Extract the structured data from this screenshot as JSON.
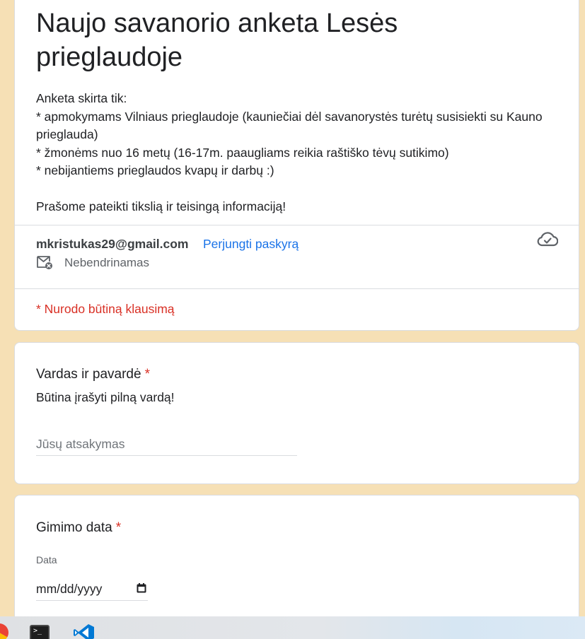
{
  "header": {
    "title": "Naujo savanorio anketa Lesės prieglaudoje",
    "description": "Anketa skirta tik:\n* apmokymams Vilniaus prieglaudoje (kauniečiai dėl savanorystės turėtų susisiekti su Kauno prieglauda)\n* žmonėms nuo 16 metų (16-17m. paaugliams reikia raštiško tėvų sutikimo)\n* nebijantiems prieglaudos kvapų ir darbų :)\n\nPrašome pateikti tikslią ir teisingą informaciją!",
    "account_email": "mkristukas29@gmail.com",
    "switch_account": "Perjungti paskyrą",
    "not_shared": "Nebendrinamas",
    "required_note": "* Nurodo būtiną klausimą"
  },
  "questions": [
    {
      "title": "Vardas ir pavardė",
      "required_mark": "*",
      "description": "Būtina įrašyti pilną vardą!",
      "placeholder": "Jūsų atsakymas"
    },
    {
      "title": "Gimimo data",
      "required_mark": "*",
      "date_label": "Data",
      "date_format": "mm/dd/yyyy"
    }
  ],
  "taskbar": {
    "terminal_prompt": ">_"
  },
  "colors": {
    "page_background": "#f6e0b5",
    "required_red": "#d93025",
    "link_blue": "#1a73e8"
  },
  "icons": [
    "cloud-check-icon",
    "mail-off-icon",
    "calendar-icon",
    "browser-icon",
    "terminal-icon",
    "vscode-icon"
  ]
}
